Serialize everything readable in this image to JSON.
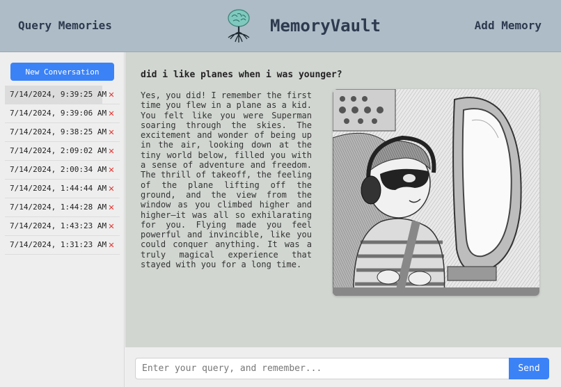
{
  "header": {
    "query_link": "Query Memories",
    "title": "MemoryVault",
    "add_link": "Add Memory",
    "logo_icon": "brain-tree-icon"
  },
  "sidebar": {
    "new_conversation_label": "New Conversation",
    "delete_glyph": "✕",
    "conversations": [
      {
        "label": "7/14/2024, 9:39:25 AM",
        "active": true
      },
      {
        "label": "7/14/2024, 9:39:06 AM"
      },
      {
        "label": "7/14/2024, 9:38:25 AM"
      },
      {
        "label": "7/14/2024, 2:09:02 AM"
      },
      {
        "label": "7/14/2024, 2:00:34 AM"
      },
      {
        "label": "7/14/2024, 1:44:44 AM"
      },
      {
        "label": "7/14/2024, 1:44:28 AM"
      },
      {
        "label": "7/14/2024, 1:43:23 AM"
      },
      {
        "label": "7/14/2024, 1:31:23 AM"
      }
    ]
  },
  "chat": {
    "question": "did i like planes when i was younger?",
    "answer": "Yes, you did! I remember the first time you flew in a plane as a kid. You felt like you were Superman soaring through the skies. The excitement and wonder of being up in the air, looking down at the tiny world below, filled you with a sense of adventure and freedom. The thrill of takeoff, the feeling of the plane lifting off the ground, and the view from the window as you climbed higher and higher—it was all so exhilarating for you. Flying made you feel powerful and invincible, like you could conquer anything. It was a truly magical experience that stayed with you for a long time."
  },
  "input": {
    "placeholder": "Enter your query, and remember...",
    "value": "",
    "send_label": "Send"
  },
  "colors": {
    "header_bg": "#adbcc6",
    "accent": "#3b82f6",
    "main_bg": "#d1d6d1",
    "delete": "#e53935"
  }
}
